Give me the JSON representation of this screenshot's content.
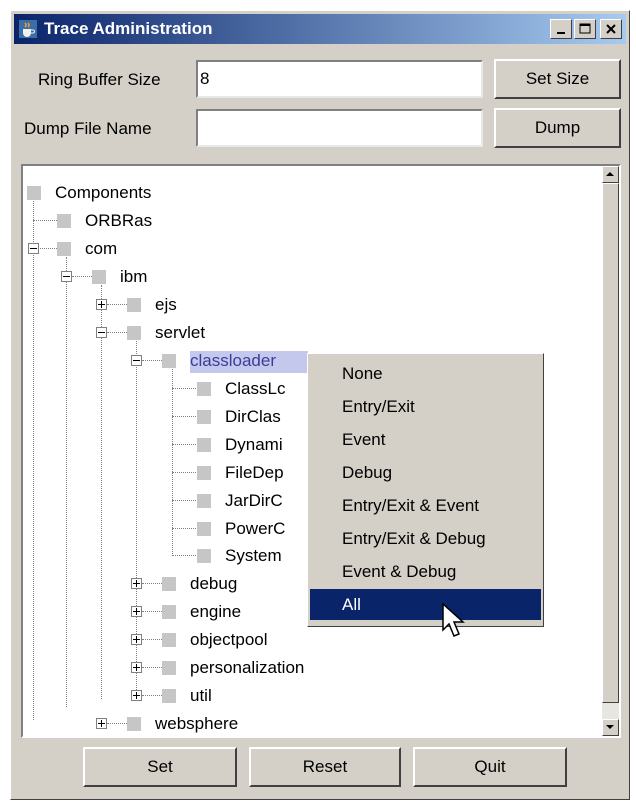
{
  "window": {
    "title": "Trace Administration"
  },
  "form": {
    "ring_buffer_label": "Ring Buffer Size",
    "ring_buffer_value": "8",
    "set_size_label": "Set Size",
    "dump_file_label": "Dump File Name",
    "dump_file_value": "",
    "dump_label": "Dump"
  },
  "tree": {
    "nodes": [
      {
        "label": "Components"
      },
      {
        "label": "ORBRas"
      },
      {
        "label": "com",
        "state": "expanded"
      },
      {
        "label": "ibm",
        "state": "expanded"
      },
      {
        "label": "ejs",
        "state": "collapsed"
      },
      {
        "label": "servlet",
        "state": "expanded"
      },
      {
        "label": "classloader",
        "state": "expanded",
        "selected": true
      },
      {
        "label": "ClassLc"
      },
      {
        "label": "DirClas"
      },
      {
        "label": "Dynami"
      },
      {
        "label": "FileDep"
      },
      {
        "label": "JarDirC"
      },
      {
        "label": "PowerC"
      },
      {
        "label": "System"
      },
      {
        "label": "debug",
        "state": "collapsed"
      },
      {
        "label": "engine",
        "state": "collapsed"
      },
      {
        "label": "objectpool",
        "state": "collapsed"
      },
      {
        "label": "personalization",
        "state": "collapsed"
      },
      {
        "label": "util",
        "state": "collapsed"
      },
      {
        "label": "websphere",
        "state": "collapsed"
      }
    ]
  },
  "popup_menu": {
    "items": [
      "None",
      "Entry/Exit",
      "Event",
      "Debug",
      "Entry/Exit & Event",
      "Entry/Exit & Debug",
      "Event & Debug",
      "All"
    ],
    "highlighted": "All"
  },
  "bottom_buttons": {
    "set": "Set",
    "reset": "Reset",
    "quit": "Quit"
  },
  "colors": {
    "title_start": "#0a246a",
    "title_end": "#a6caf0",
    "menu_highlight": "#0a246a",
    "selection": "#c4c8ec",
    "face": "#d4d0c8"
  },
  "icons": [
    "java-cup-icon",
    "minimize-icon",
    "maximize-icon",
    "close-icon",
    "scroll-up-icon",
    "scroll-down-icon",
    "mouse-cursor-icon"
  ]
}
